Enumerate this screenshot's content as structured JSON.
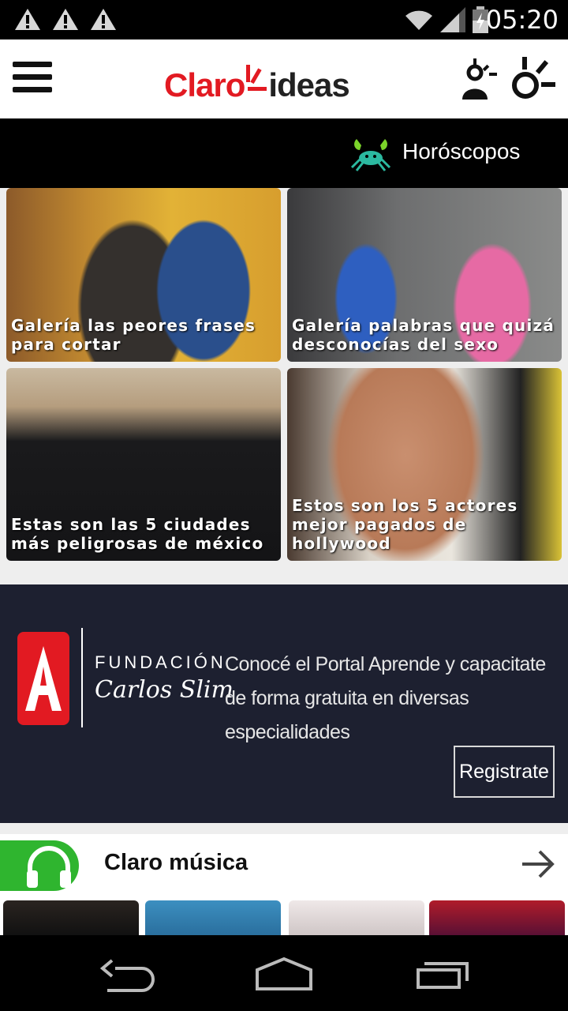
{
  "status_bar": {
    "time": "05:20",
    "notifications": [
      "warning-icon",
      "warning-icon",
      "warning-icon"
    ],
    "icons": [
      "wifi-icon",
      "signal-icon",
      "battery-icon"
    ]
  },
  "header": {
    "logo": {
      "part1": "Claro",
      "part2": "ideas"
    },
    "actions": [
      "user-light-icon",
      "bulb-icon"
    ]
  },
  "horoscope": {
    "label": "Horóscopos",
    "icon": "crab-icon"
  },
  "cards": [
    {
      "caption": "Galería las peores frases para cortar"
    },
    {
      "caption": "Galería palabras que quizá desconocías del sexo"
    },
    {
      "caption": "Estas son las 5 ciudades más peligrosas de méxico"
    },
    {
      "caption": "Estos son los 5 actores mejor pagados de hollywood"
    }
  ],
  "ad": {
    "org_line1": "FUNDACIÓN",
    "org_line2": "Carlos Slim",
    "text": "Conocé el Portal Aprende y capacitate de forma gratuita en diversas especialidades",
    "button": "Registrate"
  },
  "music": {
    "title": "Claro música"
  },
  "colors": {
    "brand_red": "#e21a22",
    "music_green": "#2fb52f",
    "ad_bg": "#1d2030"
  }
}
